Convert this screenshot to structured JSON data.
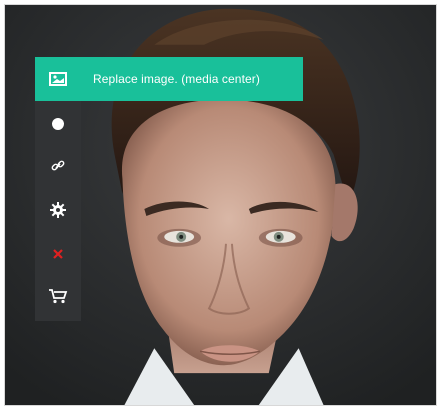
{
  "photo": {
    "icon": "portrait-photo"
  },
  "replace_tip": {
    "label": "Replace image. (media center)",
    "icon": "image-icon",
    "color": "#19c09a"
  },
  "toolbar": {
    "background": "#313335",
    "tools": [
      {
        "icon": "circle-icon"
      },
      {
        "icon": "link-icon"
      },
      {
        "icon": "gear-icon"
      },
      {
        "icon": "close-icon",
        "color": "#e02020"
      },
      {
        "icon": "cart-icon"
      }
    ]
  }
}
